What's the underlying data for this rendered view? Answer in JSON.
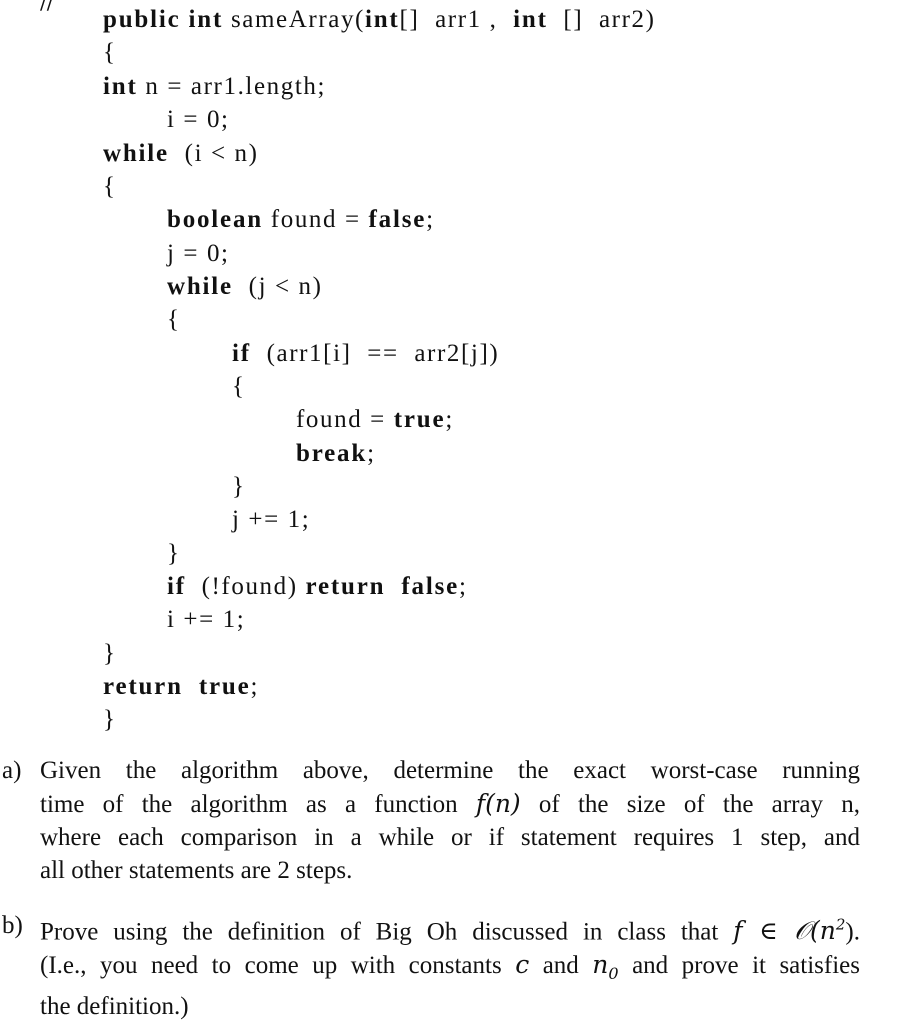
{
  "top_fragment": "//",
  "code": {
    "lines": [
      {
        "kw1": "public int",
        "rest1": " sameArray(",
        "kw2": "int",
        "rest2": "[]  arr1 ,  ",
        "kw3": "int",
        "rest3": "  []  arr2)"
      },
      {
        "text": "{"
      },
      {
        "kw": "int",
        "rest": " n = arr1.length;"
      },
      {
        "text": "i = 0;"
      },
      {
        "kw": "while",
        "rest": "  (i < n)"
      },
      {
        "text": "{"
      },
      {
        "kw": "boolean",
        "rest": " found = ",
        "kw2": "false",
        "rest2": ";"
      },
      {
        "text": "j = 0;"
      },
      {
        "kw": "while",
        "rest": "  (j < n)"
      },
      {
        "text": "{"
      },
      {
        "kw": "if",
        "rest": "  (arr1[i]  ==  arr2[j])"
      },
      {
        "text": "{"
      },
      {
        "pre": "found = ",
        "kw": "true",
        "rest": ";"
      },
      {
        "kw": "break",
        "rest": ";"
      },
      {
        "text": "}"
      },
      {
        "text": "j += 1;"
      },
      {
        "text": "}"
      },
      {
        "kw": "if",
        "rest": "  (!found) ",
        "kw2": "return  false",
        "rest2": ";"
      },
      {
        "text": "i += 1;"
      },
      {
        "text": "}"
      },
      {
        "kw": "return  true",
        "rest": ";"
      },
      {
        "text": "}"
      }
    ]
  },
  "questions": [
    {
      "label": "a)",
      "lines": [
        "Given the algorithm above, determine the exact worst-case running",
        [
          "time of the algorithm as a function ",
          "f(n)",
          " of the size of the array n,"
        ],
        "where each comparison in a while or if statement requires 1 step, and",
        "all other statements are 2 steps."
      ]
    },
    {
      "label": "b)",
      "lines": [
        [
          "Prove using the definition of Big Oh discussed in class that ",
          "f ∈ 𝒪(n",
          "2",
          ")."
        ],
        [
          "(I.e., you need to come up with constants ",
          "c",
          " and ",
          "n",
          "0",
          " and prove it satisfies"
        ],
        "the definition.)"
      ]
    }
  ]
}
